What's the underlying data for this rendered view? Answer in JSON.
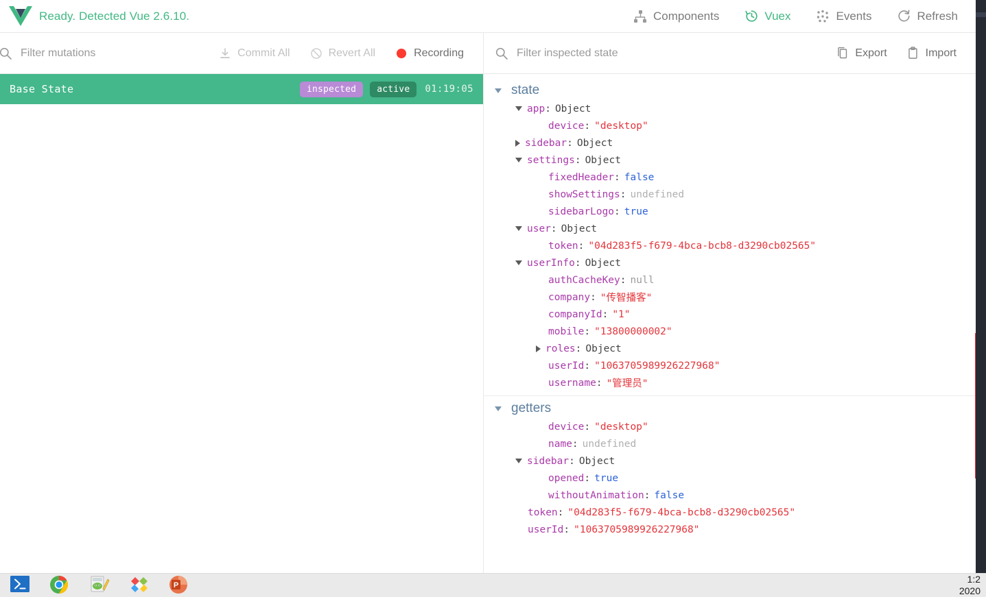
{
  "topbar": {
    "logo_icon": "vue-logo-icon",
    "status": "Ready. Detected Vue 2.6.10.",
    "nav": [
      {
        "label": "Components",
        "icon": "components-tree-icon",
        "active": false
      },
      {
        "label": "Vuex",
        "icon": "vuex-history-icon",
        "active": true
      },
      {
        "label": "Events",
        "icon": "events-dots-icon",
        "active": false
      },
      {
        "label": "Refresh",
        "icon": "refresh-icon",
        "active": false
      }
    ]
  },
  "mutations_toolbar": {
    "search_icon": "search-icon",
    "search_value": "",
    "search_placeholder": "Filter mutations",
    "commit_all": "Commit All",
    "revert_all": "Revert All",
    "recording": "Recording"
  },
  "inspector_toolbar": {
    "search_icon": "search-icon",
    "search_value": "",
    "search_placeholder": "Filter inspected state",
    "export": "Export",
    "import": "Import"
  },
  "mutations_list": [
    {
      "label": "Base State",
      "badge_inspected": "inspected",
      "badge_active": "active",
      "timestamp": "01:19:05"
    }
  ],
  "inspector": {
    "sections": [
      {
        "title": "state",
        "expanded": true,
        "rows": [
          {
            "indent": 1,
            "toggle": "down",
            "key": "app",
            "sep": ":",
            "value": "Object",
            "vtype": "obj"
          },
          {
            "indent": 2,
            "toggle": "none",
            "key": "device",
            "sep": ":",
            "value": "\"desktop\"",
            "vtype": "string"
          },
          {
            "indent": 1,
            "toggle": "right",
            "key": "sidebar",
            "sep": ":",
            "value": "Object",
            "vtype": "obj"
          },
          {
            "indent": 1,
            "toggle": "down",
            "key": "settings",
            "sep": ":",
            "value": "Object",
            "vtype": "obj"
          },
          {
            "indent": 2,
            "toggle": "none",
            "key": "fixedHeader",
            "sep": ":",
            "value": "false",
            "vtype": "bool"
          },
          {
            "indent": 2,
            "toggle": "none",
            "key": "showSettings",
            "sep": ":",
            "value": "undefined",
            "vtype": "undef"
          },
          {
            "indent": 2,
            "toggle": "none",
            "key": "sidebarLogo",
            "sep": ":",
            "value": "true",
            "vtype": "bool"
          },
          {
            "indent": 1,
            "toggle": "down",
            "key": "user",
            "sep": ":",
            "value": "Object",
            "vtype": "obj"
          },
          {
            "indent": 2,
            "toggle": "none",
            "key": "token",
            "sep": ":",
            "value": "\"04d283f5-f679-4bca-bcb8-d3290cb02565\"",
            "vtype": "string"
          },
          {
            "indent": 1,
            "toggle": "down",
            "key": "userInfo",
            "sep": ":",
            "value": "Object",
            "vtype": "obj"
          },
          {
            "indent": 2,
            "toggle": "none",
            "key": "authCacheKey",
            "sep": ":",
            "value": "null",
            "vtype": "null"
          },
          {
            "indent": 2,
            "toggle": "none",
            "key": "company",
            "sep": ":",
            "value": "\"传智播客\"",
            "vtype": "string"
          },
          {
            "indent": 2,
            "toggle": "none",
            "key": "companyId",
            "sep": ":",
            "value": "\"1\"",
            "vtype": "string"
          },
          {
            "indent": 2,
            "toggle": "none",
            "key": "mobile",
            "sep": ":",
            "value": "\"13800000002\"",
            "vtype": "string"
          },
          {
            "indent": 2,
            "toggle": "right",
            "key": "roles",
            "sep": ":",
            "value": "Object",
            "vtype": "obj"
          },
          {
            "indent": 2,
            "toggle": "none",
            "key": "userId",
            "sep": ":",
            "value": "\"1063705989926227968\"",
            "vtype": "string"
          },
          {
            "indent": 2,
            "toggle": "none",
            "key": "username",
            "sep": ":",
            "value": "\"管理员\"",
            "vtype": "string"
          }
        ]
      },
      {
        "title": "getters",
        "expanded": true,
        "rows": [
          {
            "indent": 2,
            "toggle": "none",
            "key": "device",
            "sep": ":",
            "value": "\"desktop\"",
            "vtype": "string"
          },
          {
            "indent": 2,
            "toggle": "none",
            "key": "name",
            "sep": ":",
            "value": "undefined",
            "vtype": "undef"
          },
          {
            "indent": 1,
            "toggle": "down",
            "key": "sidebar",
            "sep": ":",
            "value": "Object",
            "vtype": "obj"
          },
          {
            "indent": 2,
            "toggle": "none",
            "key": "opened",
            "sep": ":",
            "value": "true",
            "vtype": "bool"
          },
          {
            "indent": 2,
            "toggle": "none",
            "key": "withoutAnimation",
            "sep": ":",
            "value": "false",
            "vtype": "bool"
          },
          {
            "indent": 1,
            "toggle": "none",
            "key": "token",
            "sep": ":",
            "value": "\"04d283f5-f679-4bca-bcb8-d3290cb02565\"",
            "vtype": "string"
          },
          {
            "indent": 1,
            "toggle": "none",
            "key": "userId",
            "sep": ":",
            "value": "\"1063705989926227968\"",
            "vtype": "string"
          }
        ]
      }
    ],
    "annotation": {
      "name": "red-highlight-box",
      "color": "#f5333f"
    }
  },
  "taskbar": {
    "icons": [
      {
        "name": "powershell-icon"
      },
      {
        "name": "chrome-icon"
      },
      {
        "name": "image-editor-icon"
      },
      {
        "name": "paint-app-icon"
      },
      {
        "name": "powerpoint-icon"
      }
    ],
    "clock_time": "1:2",
    "clock_date": "2020"
  },
  "colors": {
    "accent_green": "#42b883",
    "base_state_green": "#44b78b",
    "badge_purple": "#b98ad6",
    "badge_active_green": "#2e8a63",
    "recording_red": "#ff3b30",
    "annotation_red": "#f5333f",
    "key_purple": "#a93ba9",
    "string_red": "#e3353b",
    "bool_blue": "#2c63d8",
    "section_blue": "#5c7e9e"
  }
}
